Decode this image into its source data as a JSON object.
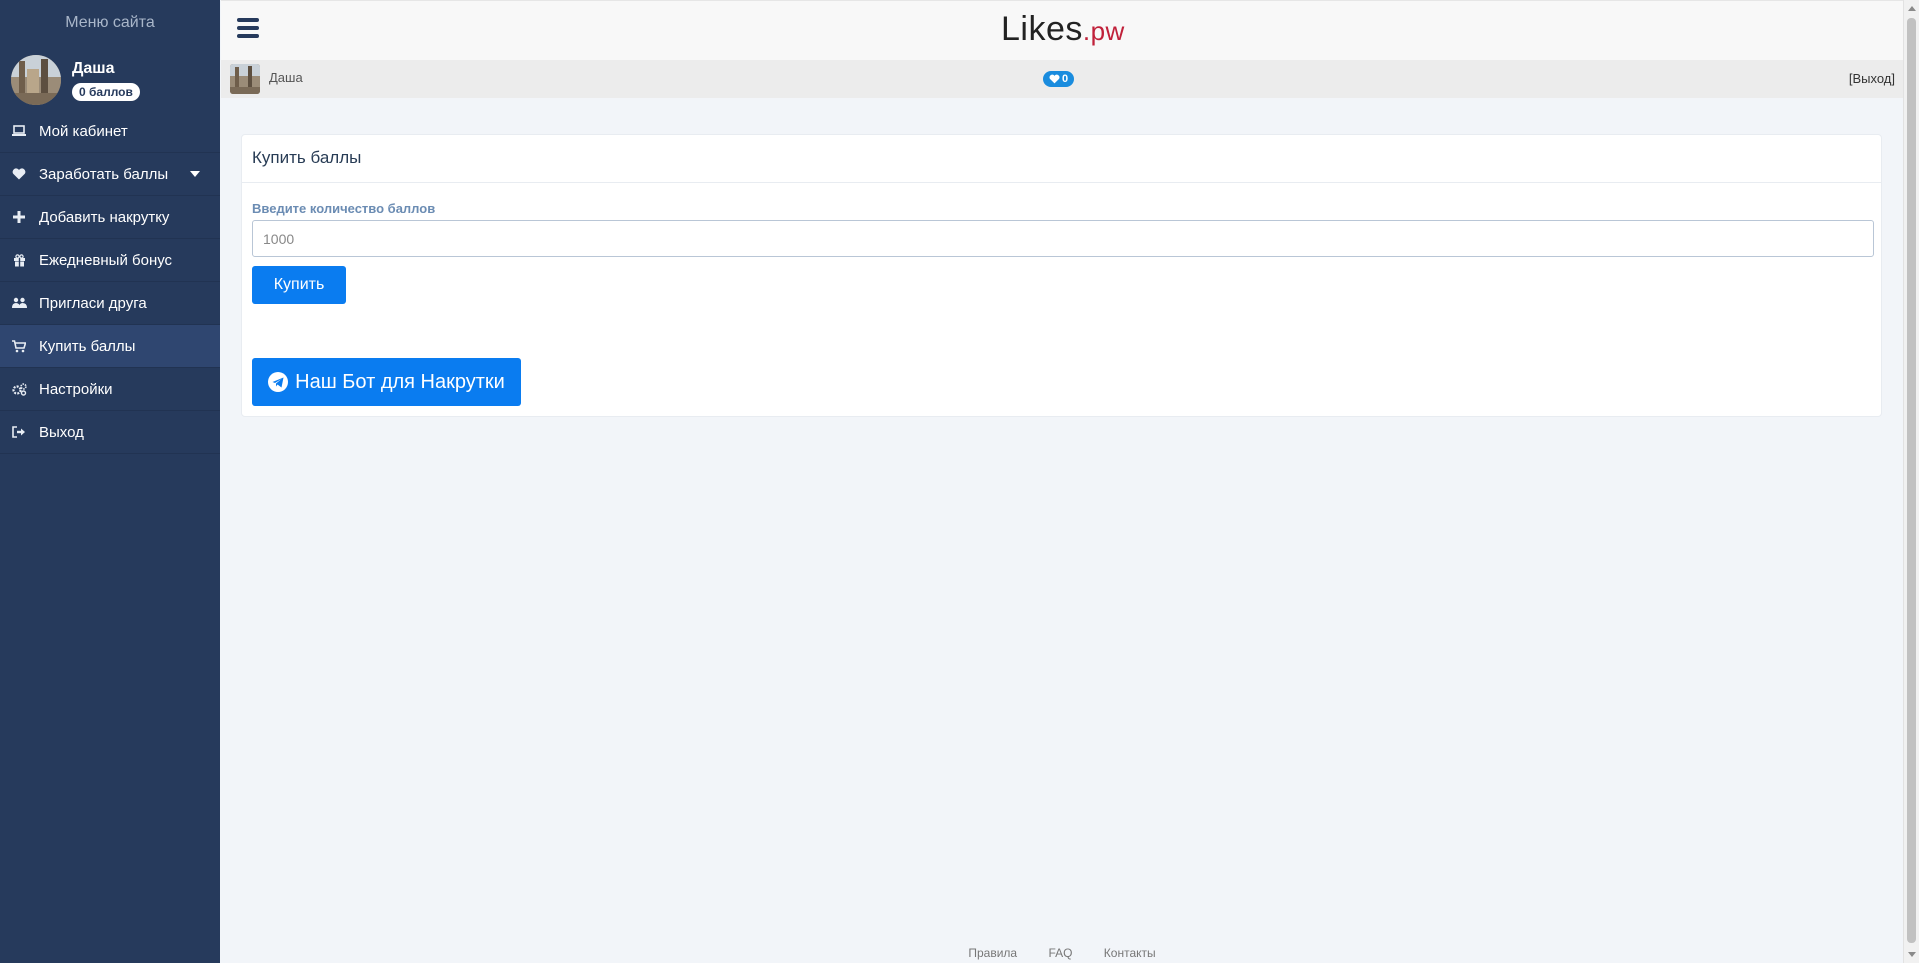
{
  "sidebar": {
    "title": "Меню сайта",
    "user": {
      "name": "Даша",
      "points": "0 баллов"
    },
    "items": [
      {
        "label": "Мой кабинет",
        "icon": "laptop-icon"
      },
      {
        "label": "Заработать баллы",
        "icon": "heart-icon",
        "has_submenu": true
      },
      {
        "label": "Добавить накрутку",
        "icon": "plus-icon"
      },
      {
        "label": "Ежедневный бонус",
        "icon": "gift-icon"
      },
      {
        "label": "Пригласи друга",
        "icon": "users-icon"
      },
      {
        "label": "Купить баллы",
        "icon": "cart-icon",
        "active": true
      },
      {
        "label": "Настройки",
        "icon": "gears-icon"
      },
      {
        "label": "Выход",
        "icon": "sign-out-icon"
      }
    ]
  },
  "header": {
    "logo_main": "Likes",
    "logo_suffix": ".pw"
  },
  "userbar": {
    "name": "Даша",
    "likes": "0",
    "logout": "[Выход]"
  },
  "card": {
    "title": "Купить баллы",
    "label": "Введите количество баллов",
    "input_placeholder": "1000",
    "buy_label": "Купить",
    "bot_label": "Наш Бот для Накрутки"
  },
  "footer": {
    "links": [
      "Правила",
      "FAQ",
      "Контакты"
    ]
  },
  "colors": {
    "sidebar_bg": "#263a5c",
    "accent": "#0a7cf0",
    "logo_suffix": "#c0213a",
    "like_badge": "#1a8cde"
  }
}
